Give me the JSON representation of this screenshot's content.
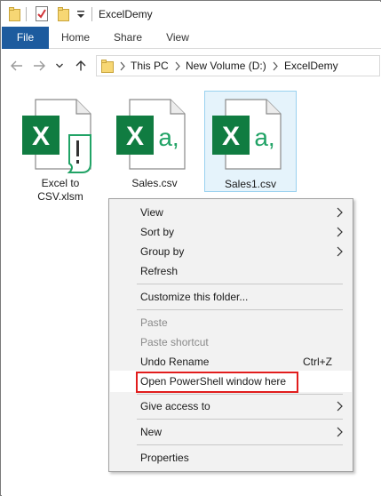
{
  "window": {
    "title": "ExcelDemy"
  },
  "ribbon": {
    "tabs": [
      {
        "label": "File"
      },
      {
        "label": "Home"
      },
      {
        "label": "Share"
      },
      {
        "label": "View"
      }
    ]
  },
  "address": {
    "crumbs": [
      "This PC",
      "New Volume (D:)",
      "ExcelDemy"
    ]
  },
  "files": [
    {
      "name_line1": "Excel to",
      "name_line2": "CSV.xlsm",
      "icon": "excel-macro-file-icon"
    },
    {
      "name": "Sales.csv",
      "icon": "excel-csv-file-icon"
    },
    {
      "name": "Sales1.csv",
      "icon": "excel-csv-file-icon",
      "selected": true
    }
  ],
  "icons": {
    "excel_letter": "X",
    "csv_mark": "a,",
    "macro_mark": "!"
  },
  "colors": {
    "excel_green": "#21a366",
    "excel_dark_green": "#107c41",
    "file_tab_blue": "#1d5b9e",
    "highlight_red": "#e11d1d"
  },
  "context_menu": {
    "view": "View",
    "sort_by": "Sort by",
    "group_by": "Group by",
    "refresh": "Refresh",
    "customize": "Customize this folder...",
    "paste": "Paste",
    "paste_shortcut": "Paste shortcut",
    "undo_rename": "Undo Rename",
    "undo_shortcut": "Ctrl+Z",
    "open_powershell": "Open PowerShell window here",
    "give_access": "Give access to",
    "new": "New",
    "properties": "Properties"
  }
}
